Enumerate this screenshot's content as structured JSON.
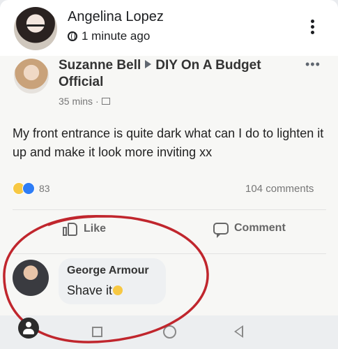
{
  "post": {
    "author": "Angelina Lopez",
    "time": "1 minute ago",
    "privacy_icon": "globe-icon",
    "menu_icon": "more-vertical-icon"
  },
  "shared_screenshot": {
    "author": "Suzanne Bell",
    "group": "DIY On A Budget Official",
    "time": "35 mins",
    "more": "•••",
    "text": "My front entrance is quite dark what can I do to lighten it up and make it look more inviting xx",
    "reaction_count": "83",
    "comments_count": "104 comments",
    "like_label": "Like",
    "comment_label": "Comment",
    "comment": {
      "author": "George Armour",
      "text": "Shave it"
    },
    "annotation_color": "#c0262d"
  }
}
